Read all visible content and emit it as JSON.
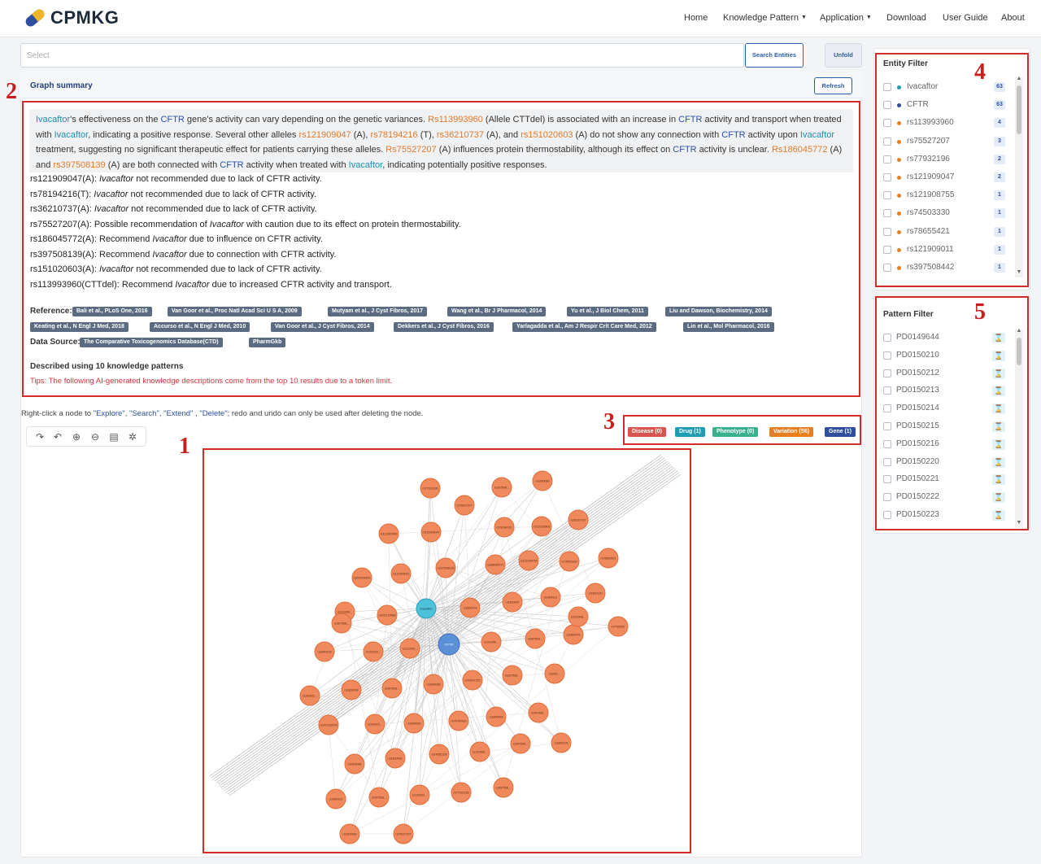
{
  "brand": "CPMKG",
  "nav": {
    "home": "Home",
    "knowledge_pattern": "Knowledge Pattern",
    "application": "Application",
    "download": "Download",
    "user_guide": "User Guide",
    "about": "About"
  },
  "search": {
    "placeholder": "Select",
    "button": "Search Entities",
    "unfold": "Unfold"
  },
  "summary": {
    "title": "Graph summary",
    "refresh": "Refresh",
    "text": [
      {
        "t": "Ivacaftor",
        "c": "teal"
      },
      {
        "t": "'s effectiveness on the "
      },
      {
        "t": "CFTR",
        "c": "blue"
      },
      {
        "t": " gene's activity can vary depending on the genetic variances. "
      },
      {
        "t": "Rs113993960",
        "c": "orange"
      },
      {
        "t": " (Allele CTTdel) is associated with an increase in "
      },
      {
        "t": "CFTR",
        "c": "blue"
      },
      {
        "t": " activity and transport when treated with "
      },
      {
        "t": "Ivacaftor",
        "c": "teal"
      },
      {
        "t": ", indicating a positive response. Several other alleles "
      },
      {
        "t": "rs121909047",
        "c": "orange"
      },
      {
        "t": " (A), "
      },
      {
        "t": "rs78194216",
        "c": "orange"
      },
      {
        "t": " (T), "
      },
      {
        "t": "rs36210737",
        "c": "orange"
      },
      {
        "t": " (A), and "
      },
      {
        "t": "rs151020603",
        "c": "orange"
      },
      {
        "t": " (A) do not show any connection with "
      },
      {
        "t": "CFTR",
        "c": "blue"
      },
      {
        "t": " activity upon "
      },
      {
        "t": "Ivacaftor",
        "c": "teal"
      },
      {
        "t": " treatment, suggesting no significant therapeutic effect for patients carrying these alleles. "
      },
      {
        "t": "Rs75527207",
        "c": "orange"
      },
      {
        "t": " (A) influences protein thermostability, although its effect on "
      },
      {
        "t": "CFTR",
        "c": "blue"
      },
      {
        "t": " activity is unclear. "
      },
      {
        "t": "Rs186045772",
        "c": "orange"
      },
      {
        "t": " (A) and "
      },
      {
        "t": "rs397508139",
        "c": "orange"
      },
      {
        "t": " (A) are both connected with "
      },
      {
        "t": "CFTR",
        "c": "blue"
      },
      {
        "t": " activity when treated with "
      },
      {
        "t": "Ivacaftor",
        "c": "teal"
      },
      {
        "t": ", indicating potentially positive responses."
      }
    ],
    "recommendations": [
      {
        "variant": "rs121909047(A):",
        "pre": "",
        "drug": "Ivacaftor",
        "post": " not recommended due to lack of CFTR activity."
      },
      {
        "variant": "rs78194216(T):",
        "pre": "",
        "drug": "Ivacaftor",
        "post": " not recommended due to lack of CFTR activity."
      },
      {
        "variant": "rs36210737(A):",
        "pre": "",
        "drug": "Ivacaftor",
        "post": " not recommended due to lack of CFTR activity."
      },
      {
        "variant": "rs75527207(A):",
        "pre": "Possible recommendation of ",
        "drug": "Ivacaftor",
        "post": " with caution due to its effect on protein thermostability."
      },
      {
        "variant": "rs186045772(A):",
        "pre": "Recommend ",
        "drug": "Ivacaftor",
        "post": " due to influence on CFTR activity."
      },
      {
        "variant": "rs397508139(A):",
        "pre": "Recommend ",
        "drug": "Ivacaftor",
        "post": " due to connection with CFTR activity."
      },
      {
        "variant": "rs151020603(A):",
        "pre": "",
        "drug": "Ivacaftor",
        "post": " not recommended due to lack of CFTR activity."
      },
      {
        "variant": "rs113993960(CTTdel):",
        "pre": "Recommend ",
        "drug": "Ivacaftor",
        "post": " due to increased CFTR activity and transport."
      }
    ],
    "reference_label": "Reference:",
    "references": [
      "Bali et al., PLoS One, 2016",
      "Van Goor et al., Proc Natl Acad Sci U S A, 2009",
      "Mutyam et al., J Cyst Fibros, 2017",
      "Wang et al., Br J Pharmacol, 2014",
      "Yu et al., J Biol Chem, 2011",
      "Liu and Dawson, Biochemistry, 2014",
      "Keating et al., N Engl J Med, 2018",
      "Accurso et al., N Engl J Med, 2010",
      "Van Goor et al., J Cyst Fibros, 2014",
      "Dekkers et al., J Cyst Fibros, 2016",
      "Yarlagadda et al., Am J Respir Crit Care Med, 2012",
      "Lin et al., Mol Pharmacol, 2016"
    ],
    "data_source_label": "Data Source:",
    "data_sources": [
      "The Comparative Toxicogenomics Database(CTD)",
      "PharmGkb"
    ],
    "described": "Described using 10 knowledge patterns",
    "tips": "Tips: The following AI-generated knowledge descriptions come from the top 10 results due to a token limit."
  },
  "help": {
    "prefix": "Right-click a node to ",
    "explore": "\"Explore\"",
    "search": "\"Search\"",
    "extend": "\"Extend\"",
    "delete": "\"Delete\"",
    "suffix": "; redo and undo can only be used after deleting the node."
  },
  "toolbar_icons": [
    "redo-icon",
    "undo-icon",
    "zoom-in-icon",
    "zoom-out-icon",
    "export-icon",
    "layout-icon"
  ],
  "legend": [
    {
      "label": "Disease (0)",
      "color": "#d9534f"
    },
    {
      "label": "Drug (1)",
      "color": "#1f9bb4"
    },
    {
      "label": "Phenotype (0)",
      "color": "#3bb08f"
    },
    {
      "label": "Variation (56)",
      "color": "#e67e22"
    },
    {
      "label": "Gene (1)",
      "color": "#2f4f9e"
    }
  ],
  "graph": {
    "hub_drug": "Ivacaftor",
    "hub_gene": "CFTR",
    "variation_labels": [
      "rs77932196",
      "rs397508...",
      "rs1800089",
      "rs75527207",
      "rs113993960",
      "rs121909047",
      "rs78194216",
      "rs36210737",
      "rs151020603",
      "rs186045772",
      "rs397508139",
      "rs121908755",
      "rs74503330",
      "rs78655421",
      "rs121909011",
      "rs397508442",
      "rs1800076",
      "rs1800097",
      "rs1800111",
      "rs1800120",
      "rs121908...",
      "rs202179988",
      "rs397508...",
      "rs7789561",
      "rs1800103",
      "rs193922...",
      "rs121909...",
      "rs191456...",
      "rs397508...",
      "rs1800079",
      "rs121908...",
      "rs193922...",
      "rs1800099",
      "rs397508...",
      "rs1800096",
      "rs74597325",
      "rs397508...",
      "rs2041...",
      "rs193922...",
      "rs141033578",
      "rs1800092",
      "rs74767530",
      "rs1800093",
      "rs397508...",
      "rs1800086",
      "rs1800083",
      "rs74551128",
      "rs121908...",
      "rs397508...",
      "rs1800109",
      "rs1800110",
      "rs397508...",
      "rs193922..."
    ]
  },
  "entity_filter": {
    "title": "Entity Filter",
    "items": [
      {
        "label": "Ivacaftor",
        "color": "#1f9bb4",
        "count": "63"
      },
      {
        "label": "CFTR",
        "color": "#2f4f9e",
        "count": "63"
      },
      {
        "label": "rs113993960",
        "color": "#e67e22",
        "count": "4"
      },
      {
        "label": "rs75527207",
        "color": "#e67e22",
        "count": "3"
      },
      {
        "label": "rs77932196",
        "color": "#e67e22",
        "count": "2"
      },
      {
        "label": "rs121909047",
        "color": "#e67e22",
        "count": "2"
      },
      {
        "label": "rs121908755",
        "color": "#e67e22",
        "count": "1"
      },
      {
        "label": "rs74503330",
        "color": "#e67e22",
        "count": "1"
      },
      {
        "label": "rs78655421",
        "color": "#e67e22",
        "count": "1"
      },
      {
        "label": "rs121909011",
        "color": "#e67e22",
        "count": "1"
      },
      {
        "label": "rs397508442",
        "color": "#e67e22",
        "count": "1"
      }
    ]
  },
  "pattern_filter": {
    "title": "Pattern Filter",
    "items": [
      "PD0149644",
      "PD0150210",
      "PD0150212",
      "PD0150213",
      "PD0150214",
      "PD0150215",
      "PD0150216",
      "PD0150220",
      "PD0150221",
      "PD0150222",
      "PD0150223"
    ]
  },
  "annotations": [
    "1",
    "2",
    "3",
    "4",
    "5"
  ]
}
